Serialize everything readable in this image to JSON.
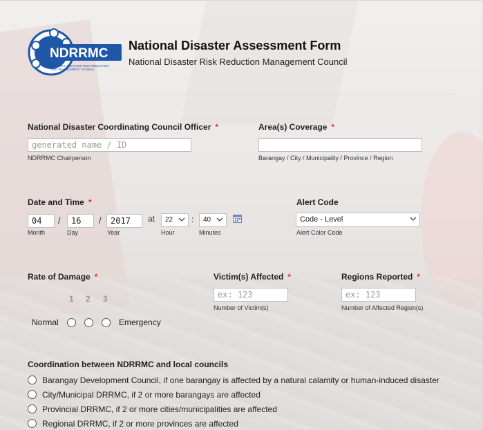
{
  "header": {
    "logo_text": "NDRRMC",
    "logo_small": "NATIONAL DISASTER RISK REDUCTION AND MANAGEMENT COUNCIL",
    "title": "National Disaster Assessment Form",
    "subtitle": "National Disaster Risk Reduction Management Council"
  },
  "officer": {
    "label": "National Disaster Coordinating Council Officer",
    "required": "*",
    "placeholder": "generated name / ID",
    "sublabel": "NDRRMC Chairperson"
  },
  "coverage": {
    "label": "Area(s) Coverage",
    "required": "*",
    "value": "",
    "sublabel": "Barangay / City / Municipality / Province / Region"
  },
  "datetime": {
    "label": "Date and Time",
    "required": "*",
    "month": "04",
    "day": "16",
    "year": "2017",
    "sep": "/",
    "at": "at",
    "colon": ":",
    "hour": "22",
    "minutes": "40",
    "month_label": "Month",
    "day_label": "Day",
    "year_label": "Year",
    "hour_label": "Hour",
    "minutes_label": "Minutes"
  },
  "alert": {
    "label": "Alert Code",
    "selected": "Code - Level",
    "sublabel": "Alert Color Code"
  },
  "damage": {
    "label": "Rate of Damage",
    "required": "*",
    "scale": [
      "1",
      "2",
      "3"
    ],
    "low_label": "Normal",
    "high_label": "Emergency"
  },
  "victims": {
    "label": "Victim(s) Affected",
    "required": "*",
    "placeholder": "ex: 123",
    "sublabel": "Number of Victim(s)"
  },
  "regions": {
    "label": "Regions Reported",
    "required": "*",
    "placeholder": "ex: 123",
    "sublabel": "Number of Affected Region(s)"
  },
  "coordination": {
    "label": "Coordination between NDRRMC and local councils",
    "options": [
      "Barangay Development Council, if one barangay is affected by a natural calamity or human-induced disaster",
      "City/Municipal DRRMC, if 2 or more barangays are affected",
      "Provincial DRRMC, if 2 or more cities/municipalities are affected",
      "Regional DRRMC, if 2 or more provinces are affected"
    ]
  },
  "colors": {
    "required": "#e0303a",
    "logo_blue": "#1f57a8"
  }
}
